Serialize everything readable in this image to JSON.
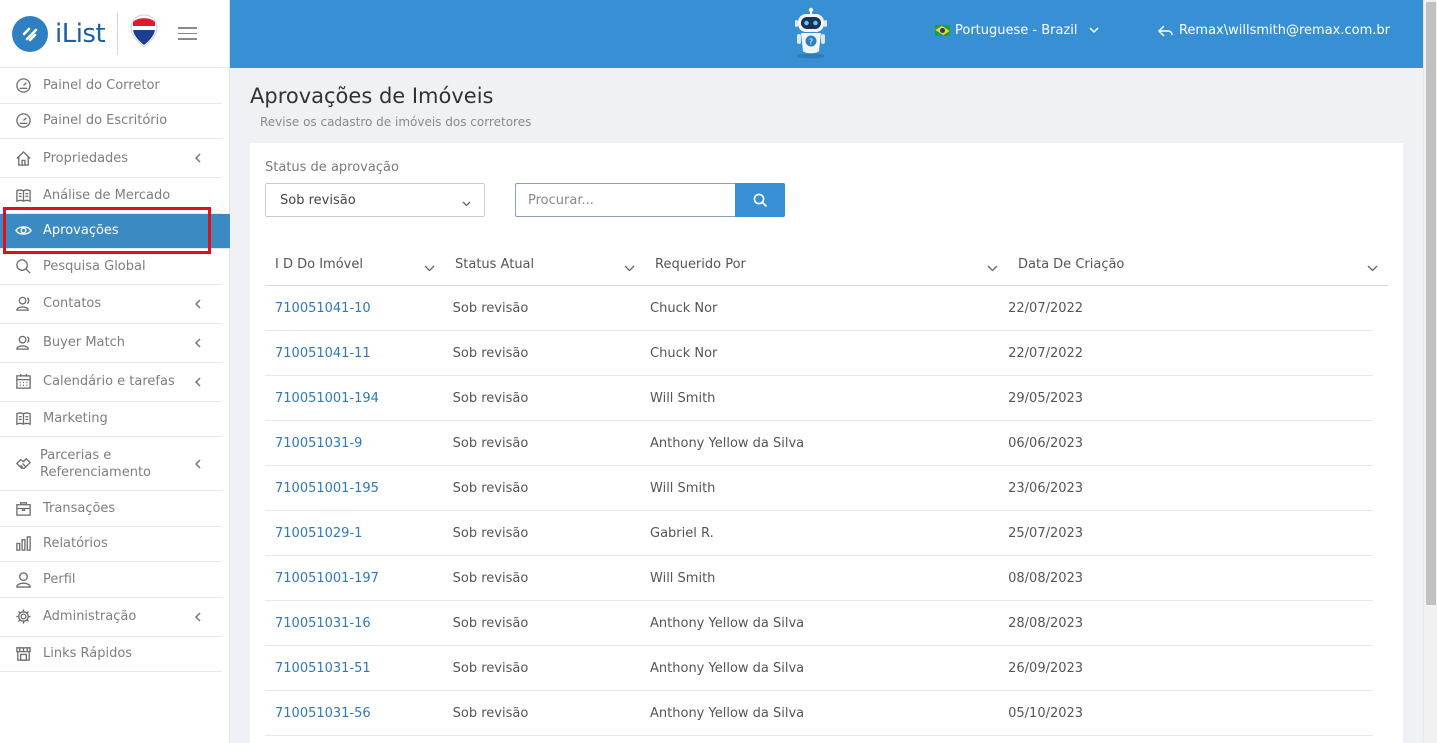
{
  "brand": {
    "name": "iList"
  },
  "header": {
    "language": "Portuguese - Brazil",
    "user": "Remax\\willsmith@remax.com.br"
  },
  "sidebar": {
    "items": [
      {
        "label": "Painel do Corretor",
        "icon": "gauge-icon"
      },
      {
        "label": "Painel do Escritório",
        "icon": "gauge-icon"
      },
      {
        "label": "Propriedades",
        "icon": "home-icon"
      },
      {
        "label": "Análise de Mercado",
        "icon": "book-icon"
      },
      {
        "label": "Aprovações",
        "icon": "eye-icon"
      },
      {
        "label": "Pesquisa Global",
        "icon": "search-icon"
      },
      {
        "label": "Contatos",
        "icon": "contacts-icon"
      },
      {
        "label": "Buyer Match",
        "icon": "contacts-icon"
      },
      {
        "label": "Calendário e tarefas",
        "icon": "calendar-icon"
      },
      {
        "label": "Marketing",
        "icon": "book-icon"
      },
      {
        "label": "Parcerias e Referenciamento",
        "icon": "handshake-icon"
      },
      {
        "label": "Transações",
        "icon": "briefcase-icon"
      },
      {
        "label": "Relatórios",
        "icon": "bar-chart-icon"
      },
      {
        "label": "Perfil",
        "icon": "user-icon"
      },
      {
        "label": "Administração",
        "icon": "gear-icon"
      },
      {
        "label": "Links Rápidos",
        "icon": "store-icon"
      }
    ]
  },
  "page": {
    "title": "Aprovações de Imóveis",
    "subtitle": "Revise os cadastro de imóveis dos corretores"
  },
  "filters": {
    "status_label": "Status de aprovação",
    "status_value": "Sob revisão",
    "search_placeholder": "Procurar..."
  },
  "table": {
    "headers": [
      "I D Do Imóvel",
      "Status Atual",
      "Requerido Por",
      "Data De Criação"
    ],
    "rows": [
      {
        "id": "710051041-10",
        "status": "Sob revisão",
        "requested_by": "Chuck Nor",
        "created": "22/07/2022"
      },
      {
        "id": "710051041-11",
        "status": "Sob revisão",
        "requested_by": "Chuck Nor",
        "created": "22/07/2022"
      },
      {
        "id": "710051001-194",
        "status": "Sob revisão",
        "requested_by": "Will Smith",
        "created": "29/05/2023"
      },
      {
        "id": "710051031-9",
        "status": "Sob revisão",
        "requested_by": "Anthony Yellow da Silva",
        "created": "06/06/2023"
      },
      {
        "id": "710051001-195",
        "status": "Sob revisão",
        "requested_by": "Will Smith",
        "created": "23/06/2023"
      },
      {
        "id": "710051029-1",
        "status": "Sob revisão",
        "requested_by": "Gabriel R.",
        "created": "25/07/2023"
      },
      {
        "id": "710051001-197",
        "status": "Sob revisão",
        "requested_by": "Will Smith",
        "created": "08/08/2023"
      },
      {
        "id": "710051031-16",
        "status": "Sob revisão",
        "requested_by": "Anthony Yellow da Silva",
        "created": "28/08/2023"
      },
      {
        "id": "710051031-51",
        "status": "Sob revisão",
        "requested_by": "Anthony Yellow da Silva",
        "created": "26/09/2023"
      },
      {
        "id": "710051031-56",
        "status": "Sob revisão",
        "requested_by": "Anthony Yellow da Silva",
        "created": "05/10/2023"
      }
    ]
  },
  "colors": {
    "header_bg": "#3790d4",
    "active_nav_bg": "#3c8ac2",
    "link": "#2f79b9",
    "highlight": "#e0101a"
  }
}
